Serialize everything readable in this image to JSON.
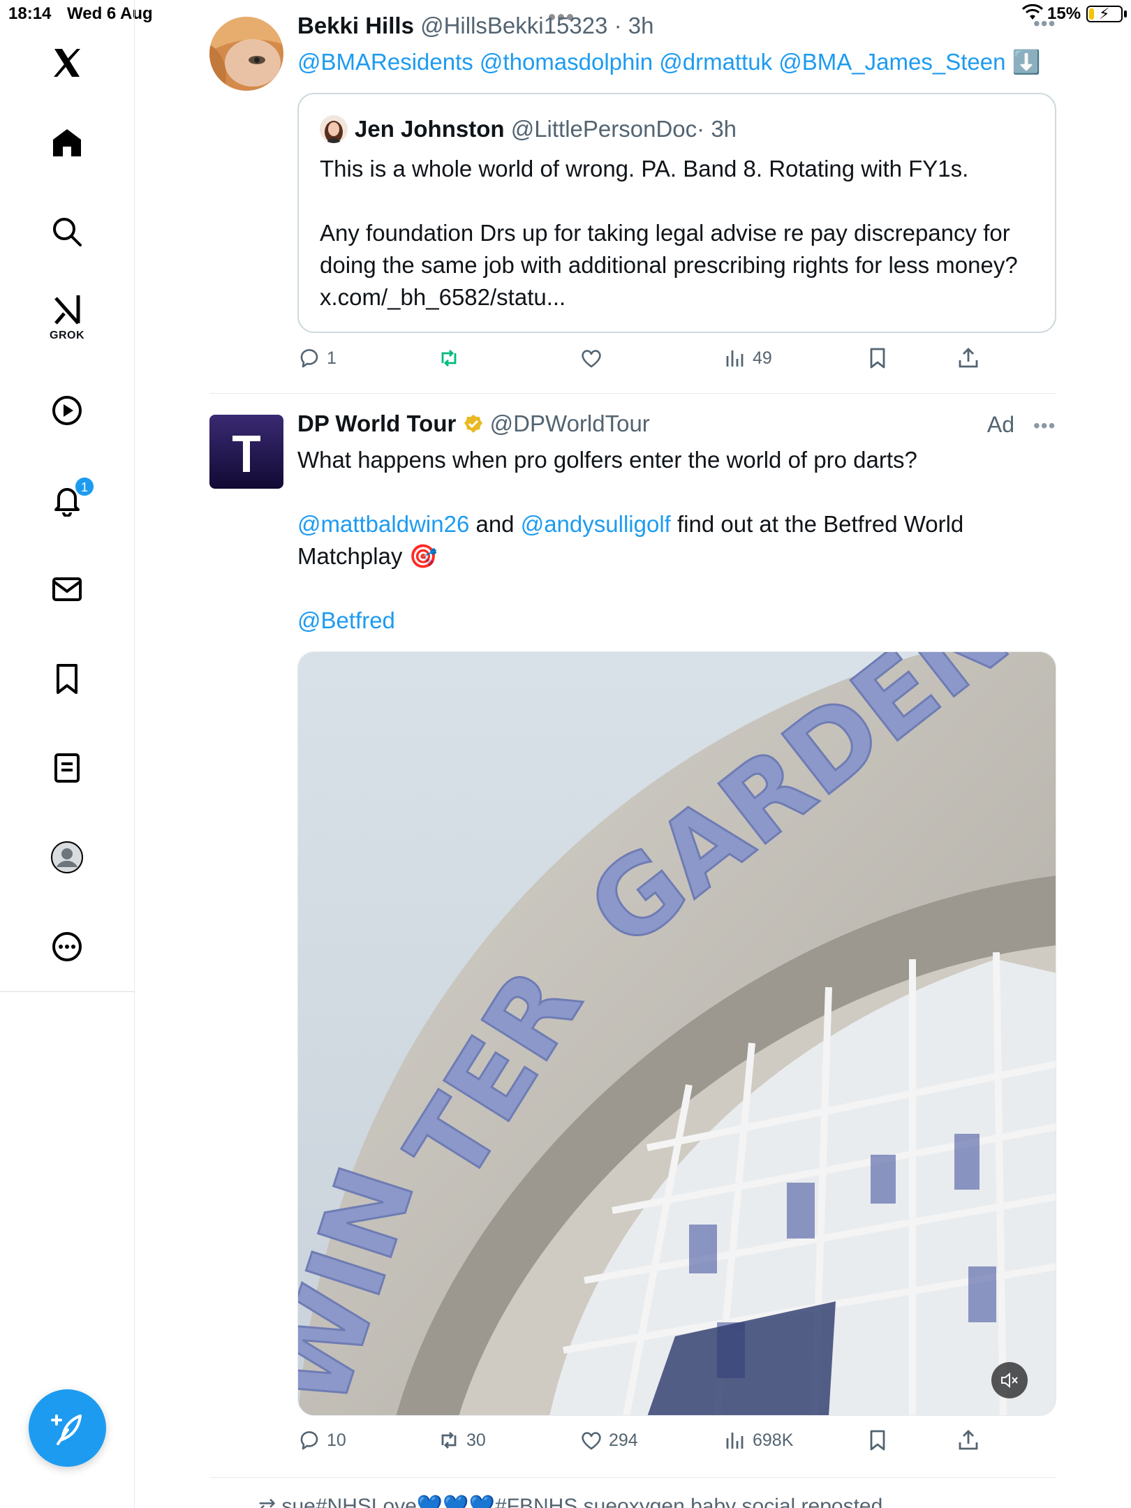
{
  "status_bar": {
    "time": "18:14",
    "date": "Wed 6 Aug",
    "battery_pct": "15%",
    "battery_level": 0.15
  },
  "sidebar": {
    "items": [
      {
        "name": "x-logo-icon"
      },
      {
        "name": "home-icon"
      },
      {
        "name": "search-icon"
      },
      {
        "name": "grok-icon",
        "label": "GROK"
      },
      {
        "name": "video-play-icon"
      },
      {
        "name": "notifications-bell-icon",
        "badge": "1"
      },
      {
        "name": "messages-mail-icon"
      },
      {
        "name": "bookmarks-icon"
      },
      {
        "name": "lists-icon"
      },
      {
        "name": "profile-icon"
      },
      {
        "name": "more-circle-icon"
      }
    ],
    "compose_icon": "compose-feather-icon"
  },
  "posts": [
    {
      "name": "Bekki Hills",
      "handle": "@HillsBekki15323",
      "time": "· 3h",
      "mentions": "@BMAResidents @thomasdolphin @drmattuk @BMA_James_Steen",
      "emoji": "⬇️",
      "quote": {
        "name": "Jen Johnston",
        "handle": "@LittlePersonDoc",
        "time": "· 3h",
        "line1": "This is a whole world of wrong. PA. Band 8. Rotating with FY1s.",
        "line2": "Any foundation Drs up for taking legal advise re pay discrepancy for doing the same job with additional prescribing rights for less money? x.com/_bh_6582/statu..."
      },
      "actions": {
        "replies": "1",
        "reposts": "",
        "likes": "",
        "views": "49"
      }
    },
    {
      "name": "DP World Tour",
      "handle": "@DPWorldTour",
      "ad_label": "Ad",
      "text1": "What happens when pro golfers enter the world of pro darts?",
      "mention_a": "@mattbaldwin26",
      "and": " and ",
      "mention_b": "@andysulligolf",
      "text2a": " find out at the Betfred World",
      "text2b": "Matchplay 🎯",
      "mention_c": "@Betfred",
      "actions": {
        "replies": "10",
        "reposts": "30",
        "likes": "294",
        "views": "698K"
      }
    }
  ],
  "next_post_peek": "⇄ sue#NHSLove💙💙💙#FBNHS sueoxygen baby social reposted",
  "colors": {
    "accent": "#1d9bf0",
    "muted": "#536471",
    "repost_active": "#00ba7c",
    "verified": "#e8b923"
  }
}
